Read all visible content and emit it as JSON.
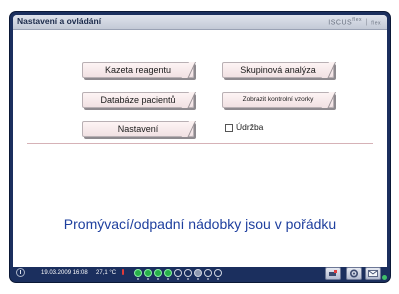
{
  "window": {
    "title": "Nastavení a ovládání",
    "brand": {
      "name": "ISCUS",
      "superscript": "flex",
      "separator": "|",
      "suffix": "flex"
    }
  },
  "buttons": {
    "kazeta": "Kazeta reagentu",
    "databaze": "Databáze pacientů",
    "nastaveni": "Nastavení",
    "skupinova": "Skupinová analýza",
    "zobrazit": "Zobrazit kontrolní vzorky"
  },
  "checkbox": {
    "label": "Údržba",
    "checked": false
  },
  "message": "Promývací/odpadní nádobky jsou v pořádku",
  "statusbar": {
    "datetime": "19.03.2009 16:08",
    "temperature": "27,1 °C",
    "slots": [
      "on",
      "on",
      "on",
      "on",
      "off",
      "off",
      "mid",
      "off",
      "off"
    ],
    "controls": [
      "settings-icon",
      "gear-icon",
      "mail-icon"
    ]
  },
  "colors": {
    "screen_frame": "#1b2f5e",
    "message_text": "#1e3f9e",
    "button_fill": "#f1e1e3",
    "slot_on": "#27b04a"
  }
}
